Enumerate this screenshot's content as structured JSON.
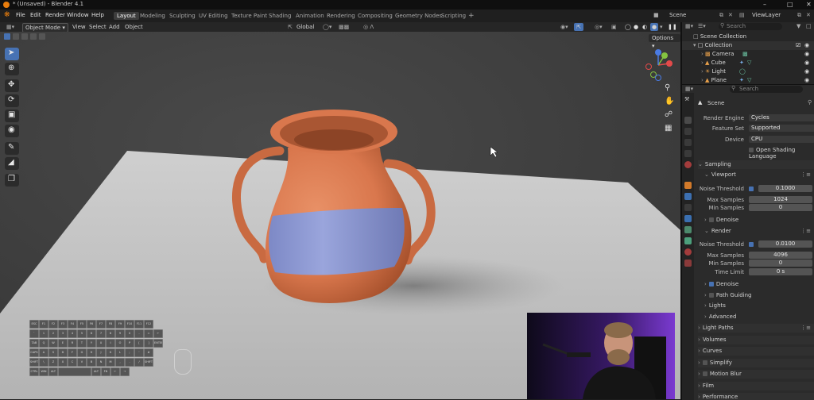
{
  "window": {
    "title": "* (Unsaved) - Blender 4.1"
  },
  "menu": {
    "file": "File",
    "edit": "Edit",
    "render": "Render",
    "window": "Window",
    "help": "Help"
  },
  "workspaces": [
    "Layout",
    "Modeling",
    "Sculpting",
    "UV Editing",
    "Texture Paint",
    "Shading",
    "Animation",
    "Rendering",
    "Compositing",
    "Geometry Nodes",
    "Scripting"
  ],
  "topright": {
    "scene": "Scene",
    "view_layer": "ViewLayer"
  },
  "viewport_header": {
    "mode": "Object Mode",
    "view": "View",
    "select": "Select",
    "add": "Add",
    "object": "Object",
    "transform_orientation": "Global",
    "options": "Options"
  },
  "outliner": {
    "search_placeholder": "Search",
    "scene_collection": "Scene Collection",
    "collection": "Collection",
    "objects": [
      "Camera",
      "Cube",
      "Light",
      "Plane"
    ]
  },
  "properties": {
    "search_placeholder": "Search",
    "context": "Scene",
    "render_engine_label": "Render Engine",
    "render_engine": "Cycles",
    "feature_set_label": "Feature Set",
    "feature_set": "Supported",
    "device_label": "Device",
    "device": "CPU",
    "osl": "Open Shading Language",
    "sampling": "Sampling",
    "viewport": "Viewport",
    "vp_noise_threshold_label": "Noise Threshold",
    "vp_noise_threshold": "0.1000",
    "vp_max_samples_label": "Max Samples",
    "vp_max_samples": "1024",
    "vp_min_samples_label": "Min Samples",
    "vp_min_samples": "0",
    "vp_denoise": "Denoise",
    "render": "Render",
    "r_noise_threshold_label": "Noise Threshold",
    "r_noise_threshold": "0.0100",
    "r_max_samples_label": "Max Samples",
    "r_max_samples": "4096",
    "r_min_samples_label": "Min Samples",
    "r_min_samples": "0",
    "r_time_limit_label": "Time Limit",
    "r_time_limit": "0 s",
    "r_denoise": "Denoise",
    "path_guiding": "Path Guiding",
    "lights": "Lights",
    "advanced": "Advanced",
    "light_paths": "Light Paths",
    "volumes": "Volumes",
    "curves": "Curves",
    "simplify": "Simplify",
    "motion_blur": "Motion Blur",
    "film": "Film",
    "performance": "Performance"
  },
  "keyboard": {
    "row1": [
      "ESC",
      "F1",
      "F2",
      "F3",
      "F4",
      "F5",
      "F6",
      "F7",
      "F8",
      "F9",
      "F10",
      "F11",
      "F12"
    ],
    "row2": [
      "`",
      "1",
      "2",
      "3",
      "4",
      "5",
      "6",
      "7",
      "8",
      "9",
      "0",
      "-",
      "=",
      "←"
    ],
    "row3": [
      "TAB",
      "Q",
      "W",
      "E",
      "R",
      "T",
      "Y",
      "U",
      "I",
      "O",
      "P",
      "[",
      "]",
      "ENTER"
    ],
    "row4": [
      "CAPS",
      "A",
      "S",
      "D",
      "F",
      "G",
      "H",
      "J",
      "K",
      "L",
      ";",
      "'",
      "#"
    ],
    "row5": [
      "SHIFT",
      "\\",
      "Z",
      "X",
      "C",
      "V",
      "B",
      "N",
      "M",
      ",",
      ".",
      "/",
      "SHIFT"
    ],
    "row6": [
      "CTRL",
      "WIN",
      "ALT",
      "",
      "ALT",
      "FN",
      "←",
      "→"
    ]
  },
  "colors": {
    "accent": "#4772b3",
    "vase": "#d9774d",
    "band": "#8f9bd3",
    "plane": "#c9c9c9"
  }
}
